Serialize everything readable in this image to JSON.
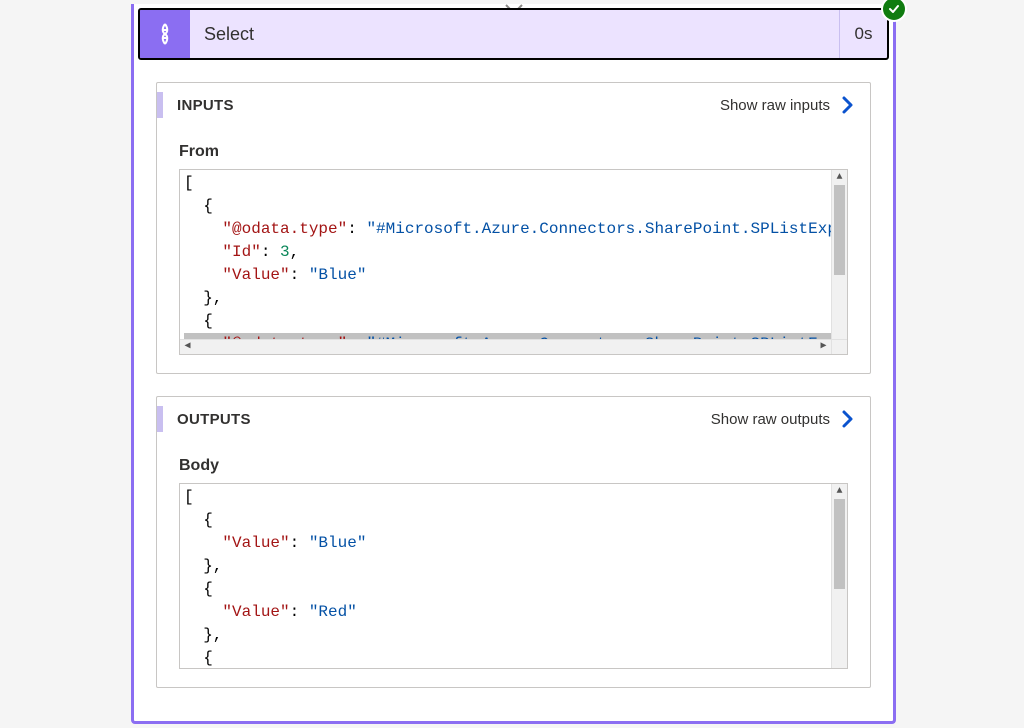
{
  "action": {
    "title": "Select",
    "duration": "0s",
    "status": "success",
    "accent_color": "#8b6ef2",
    "icon": "data-operations-select-icon"
  },
  "sections": {
    "inputs": {
      "title": "INPUTS",
      "raw_link": "Show raw inputs",
      "fields": {
        "from": {
          "label": "From",
          "json": [
            {
              "@odata.type": "#Microsoft.Azure.Connectors.SharePoint.SPListExpand",
              "Id": 3,
              "Value": "Blue"
            },
            {
              "@odata.type": "#Microsoft.Azure.Connectors.SharePoint.SPListExpand"
            }
          ],
          "tokens": [
            [
              {
                "t": "punc",
                "v": "["
              }
            ],
            [
              {
                "t": "punc",
                "v": "  {"
              }
            ],
            [
              {
                "t": "punc",
                "v": "    "
              },
              {
                "t": "key",
                "v": "\"@odata.type\""
              },
              {
                "t": "punc",
                "v": ": "
              },
              {
                "t": "str",
                "v": "\"#Microsoft.Azure.Connectors.SharePoint.SPListExpand"
              }
            ],
            [
              {
                "t": "punc",
                "v": "    "
              },
              {
                "t": "key",
                "v": "\"Id\""
              },
              {
                "t": "punc",
                "v": ": "
              },
              {
                "t": "num",
                "v": "3"
              },
              {
                "t": "punc",
                "v": ","
              }
            ],
            [
              {
                "t": "punc",
                "v": "    "
              },
              {
                "t": "key",
                "v": "\"Value\""
              },
              {
                "t": "punc",
                "v": ": "
              },
              {
                "t": "str",
                "v": "\"Blue\""
              }
            ],
            [
              {
                "t": "punc",
                "v": "  },"
              }
            ],
            [
              {
                "t": "punc",
                "v": "  {"
              }
            ],
            [
              {
                "t": "punc",
                "v": "    "
              },
              {
                "t": "key",
                "v": "\"@odata.type\""
              },
              {
                "t": "punc",
                "v": ": "
              },
              {
                "t": "str",
                "v": "\"#Microsoft.Azure.Connectors.SharePoint.SPListExpand"
              }
            ]
          ],
          "has_hscroll": true,
          "selected_line_index": 7
        }
      }
    },
    "outputs": {
      "title": "OUTPUTS",
      "raw_link": "Show raw outputs",
      "fields": {
        "body": {
          "label": "Body",
          "json": [
            {
              "Value": "Blue"
            },
            {
              "Value": "Red"
            }
          ],
          "tokens": [
            [
              {
                "t": "punc",
                "v": "["
              }
            ],
            [
              {
                "t": "punc",
                "v": "  {"
              }
            ],
            [
              {
                "t": "punc",
                "v": "    "
              },
              {
                "t": "key",
                "v": "\"Value\""
              },
              {
                "t": "punc",
                "v": ": "
              },
              {
                "t": "str",
                "v": "\"Blue\""
              }
            ],
            [
              {
                "t": "punc",
                "v": "  },"
              }
            ],
            [
              {
                "t": "punc",
                "v": "  {"
              }
            ],
            [
              {
                "t": "punc",
                "v": "    "
              },
              {
                "t": "key",
                "v": "\"Value\""
              },
              {
                "t": "punc",
                "v": ": "
              },
              {
                "t": "str",
                "v": "\"Red\""
              }
            ],
            [
              {
                "t": "punc",
                "v": "  },"
              }
            ],
            [
              {
                "t": "punc",
                "v": "  {"
              }
            ]
          ],
          "has_hscroll": false
        }
      }
    }
  }
}
